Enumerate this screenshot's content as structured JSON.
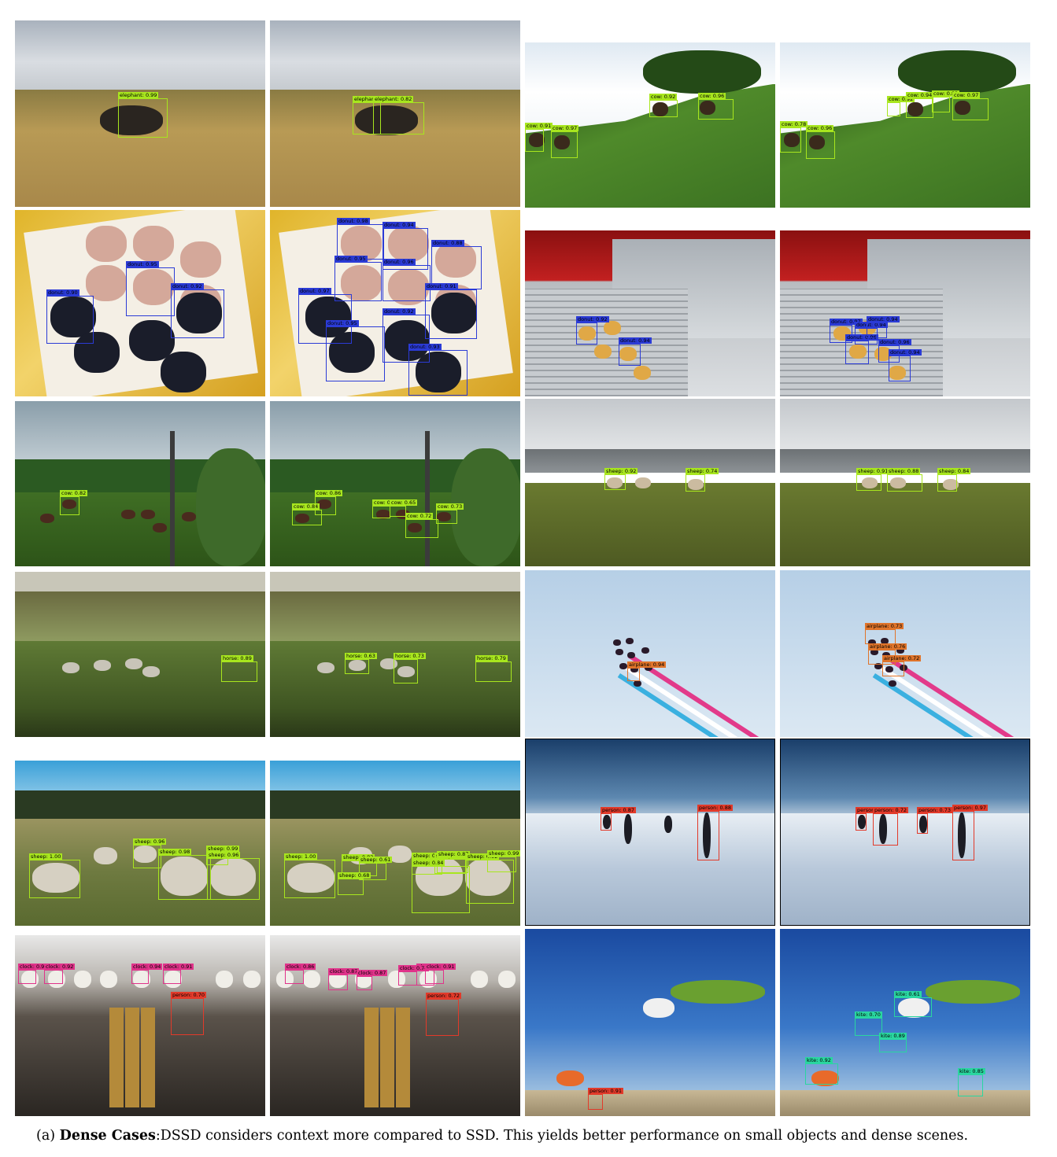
{
  "colors": {
    "elephant": "#a8e61e",
    "cow": "#a8e61e",
    "sheep": "#a8e61e",
    "horse": "#a8e61e",
    "donut": "#2b3bd6",
    "airplane": "#e0742a",
    "person": "#e23a2a",
    "clock": "#e0338a",
    "kite": "#2ad6a0"
  },
  "caption": {
    "prefix": "(a) ",
    "bold": "Dense Cases",
    "rest": ":DSSD considers context more compared to SSD. This yields better performance on small objects and dense scenes."
  },
  "panels": [
    {
      "scene": "savanna-elephants",
      "boxes": [
        {
          "cls": "elephant",
          "label": "elephant: 0.99"
        }
      ]
    },
    {
      "scene": "savanna-elephants",
      "boxes": [
        {
          "cls": "elephant",
          "label": "elephant: 0.99"
        },
        {
          "cls": "elephant",
          "label": "elephant: 0.82"
        }
      ]
    },
    {
      "scene": "hillside-cows",
      "boxes": [
        {
          "cls": "cow",
          "label": "cow: 0.91"
        },
        {
          "cls": "cow",
          "label": "cow: 0.97"
        },
        {
          "cls": "cow",
          "label": "cow: 0.92"
        },
        {
          "cls": "cow",
          "label": "cow: 0.96"
        }
      ]
    },
    {
      "scene": "hillside-cows",
      "boxes": [
        {
          "cls": "cow",
          "label": "cow: 0.78"
        },
        {
          "cls": "cow",
          "label": "cow: 0.96"
        },
        {
          "cls": "cow",
          "label": "cow: 0.92"
        },
        {
          "cls": "cow",
          "label": "cow: 0.94"
        },
        {
          "cls": "cow",
          "label": "cow: 0.82"
        },
        {
          "cls": "cow",
          "label": "cow: 0.97"
        }
      ]
    },
    {
      "scene": "donut-box",
      "boxes": [
        {
          "cls": "donut",
          "label": "donut: 0.90"
        },
        {
          "cls": "donut",
          "label": "donut: 0.95"
        },
        {
          "cls": "donut",
          "label": "donut: 0.92"
        },
        {
          "cls": "donut",
          "label": "donut: 0.88"
        }
      ]
    },
    {
      "scene": "donut-box",
      "boxes": [
        {
          "cls": "donut",
          "label": "donut: 0.98"
        },
        {
          "cls": "donut",
          "label": "donut: 0.94"
        },
        {
          "cls": "donut",
          "label": "donut: 0.88"
        },
        {
          "cls": "donut",
          "label": "donut: 0.95"
        },
        {
          "cls": "donut",
          "label": "donut: 0.97"
        },
        {
          "cls": "donut",
          "label": "donut: 0.95"
        },
        {
          "cls": "donut",
          "label": "donut: 0.96"
        },
        {
          "cls": "donut",
          "label": "donut: 0.92"
        },
        {
          "cls": "donut",
          "label": "donut: 0.93"
        },
        {
          "cls": "donut",
          "label": "donut: 0.91"
        }
      ]
    },
    {
      "scene": "fryer-donuts",
      "boxes": [
        {
          "cls": "donut",
          "label": "donut: 0.92"
        },
        {
          "cls": "donut",
          "label": "donut: 0.94"
        }
      ]
    },
    {
      "scene": "fryer-donuts",
      "boxes": [
        {
          "cls": "donut",
          "label": "donut: 0.97"
        },
        {
          "cls": "donut",
          "label": "donut: 0.94"
        },
        {
          "cls": "donut",
          "label": "donut: 0.96"
        },
        {
          "cls": "donut",
          "label": "donut: 0.94"
        },
        {
          "cls": "donut",
          "label": "donut: 0.96"
        },
        {
          "cls": "donut",
          "label": "donut: 0.94"
        }
      ]
    },
    {
      "scene": "pole-field",
      "boxes": [
        {
          "cls": "cow",
          "label": "cow: 0.82"
        }
      ]
    },
    {
      "scene": "pole-field",
      "boxes": [
        {
          "cls": "cow",
          "label": "cow: 0.84"
        },
        {
          "cls": "cow",
          "label": "cow: 0.86"
        },
        {
          "cls": "cow",
          "label": "cow: 0.67"
        },
        {
          "cls": "cow",
          "label": "cow: 0.65"
        },
        {
          "cls": "cow",
          "label": "cow: 0.72"
        },
        {
          "cls": "cow",
          "label": "cow: 0.73"
        }
      ]
    },
    {
      "scene": "moor-sheep",
      "boxes": [
        {
          "cls": "sheep",
          "label": "sheep: 0.92"
        },
        {
          "cls": "sheep",
          "label": "sheep: 0.74"
        }
      ]
    },
    {
      "scene": "moor-sheep",
      "boxes": [
        {
          "cls": "sheep",
          "label": "sheep: 0.91"
        },
        {
          "cls": "sheep",
          "label": "sheep: 0.88"
        },
        {
          "cls": "sheep",
          "label": "sheep: 0.84"
        }
      ]
    },
    {
      "scene": "misty-horses",
      "boxes": [
        {
          "cls": "horse",
          "label": "horse: 0.89"
        }
      ]
    },
    {
      "scene": "misty-horses",
      "boxes": [
        {
          "cls": "horse",
          "label": "horse: 0.63"
        },
        {
          "cls": "horse",
          "label": "horse: 0.73"
        },
        {
          "cls": "horse",
          "label": "horse: 0.79"
        }
      ]
    },
    {
      "scene": "airshow",
      "boxes": [
        {
          "cls": "airplane",
          "label": "airplane: 0.94"
        }
      ]
    },
    {
      "scene": "airshow",
      "boxes": [
        {
          "cls": "airplane",
          "label": "airplane: 0.73"
        },
        {
          "cls": "airplane",
          "label": "airplane: 0.76"
        },
        {
          "cls": "airplane",
          "label": "airplane: 0.72"
        }
      ]
    },
    {
      "scene": "pasture-sheep",
      "boxes": [
        {
          "cls": "sheep",
          "label": "sheep: 1.00"
        },
        {
          "cls": "sheep",
          "label": "sheep: 0.96"
        },
        {
          "cls": "sheep",
          "label": "sheep: 0.98"
        },
        {
          "cls": "sheep",
          "label": "sheep: 0.99"
        },
        {
          "cls": "sheep",
          "label": "sheep: 0.96"
        }
      ]
    },
    {
      "scene": "pasture-sheep",
      "boxes": [
        {
          "cls": "sheep",
          "label": "sheep: 1.00"
        },
        {
          "cls": "sheep",
          "label": "sheep: 0.83"
        },
        {
          "cls": "sheep",
          "label": "sheep: 0.61"
        },
        {
          "cls": "sheep",
          "label": "sheep: 0.68"
        },
        {
          "cls": "sheep",
          "label": "sheep: 0.84"
        },
        {
          "cls": "sheep",
          "label": "sheep: 0.85"
        },
        {
          "cls": "sheep",
          "label": "sheep: 0.84"
        },
        {
          "cls": "sheep",
          "label": "sheep: 0.87"
        },
        {
          "cls": "sheep",
          "label": "sheep: 0.92"
        },
        {
          "cls": "sheep",
          "label": "sheep: 0.99"
        }
      ]
    },
    {
      "scene": "snow-people",
      "boxes": [
        {
          "cls": "person",
          "label": "person: 0.87"
        },
        {
          "cls": "person",
          "label": "person: 0.88"
        }
      ]
    },
    {
      "scene": "snow-people",
      "boxes": [
        {
          "cls": "person",
          "label": "person: 0.71"
        },
        {
          "cls": "person",
          "label": "person: 0.72"
        },
        {
          "cls": "person",
          "label": "person: 0.73"
        },
        {
          "cls": "person",
          "label": "person: 0.97"
        }
      ]
    },
    {
      "scene": "clock-shop",
      "boxes": [
        {
          "cls": "clock",
          "label": "clock: 0.91"
        },
        {
          "cls": "clock",
          "label": "clock: 0.92"
        },
        {
          "cls": "clock",
          "label": "clock: 0.94"
        },
        {
          "cls": "clock",
          "label": "clock: 0.91"
        },
        {
          "cls": "person",
          "label": "person: 0.70"
        }
      ]
    },
    {
      "scene": "clock-shop",
      "boxes": [
        {
          "cls": "clock",
          "label": "clock: 0.86"
        },
        {
          "cls": "clock",
          "label": "clock: 0.87"
        },
        {
          "cls": "clock",
          "label": "clock: 0.87"
        },
        {
          "cls": "clock",
          "label": "clock: 0.85"
        },
        {
          "cls": "clock",
          "label": "clock: 0.74"
        },
        {
          "cls": "clock",
          "label": "clock: 0.91"
        },
        {
          "cls": "person",
          "label": "person: 0.72"
        }
      ]
    },
    {
      "scene": "kite-beach",
      "boxes": [
        {
          "cls": "person",
          "label": "person: 0.91"
        }
      ]
    },
    {
      "scene": "kite-beach",
      "boxes": [
        {
          "cls": "kite",
          "label": "kite: 0.61"
        },
        {
          "cls": "kite",
          "label": "kite: 0.70"
        },
        {
          "cls": "kite",
          "label": "kite: 0.89"
        },
        {
          "cls": "kite",
          "label": "kite: 0.92"
        },
        {
          "cls": "kite",
          "label": "kite: 0.85"
        }
      ]
    }
  ]
}
